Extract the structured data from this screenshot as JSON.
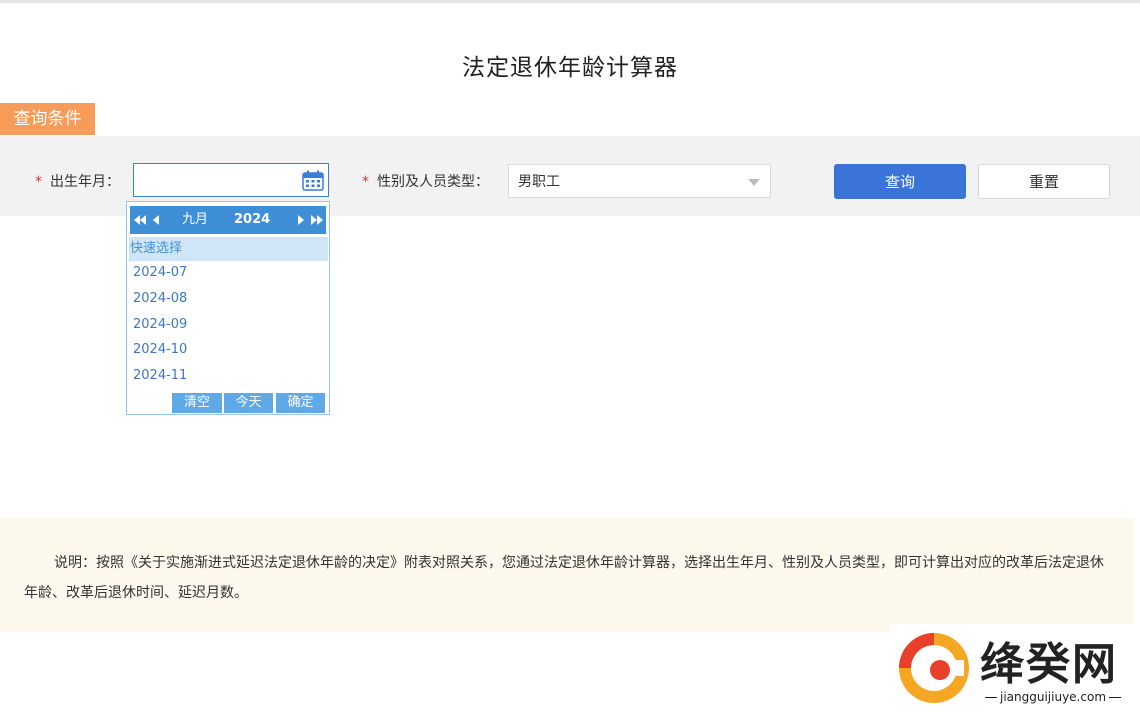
{
  "page": {
    "title": "法定退休年龄计算器"
  },
  "filter": {
    "tab_label": "查询条件",
    "required_mark": "*",
    "birth_label": "出生年月：",
    "birth_value": "",
    "type_label": "性别及人员类型：",
    "type_value": "男职工",
    "query_button": "查询",
    "reset_button": "重置"
  },
  "date_picker": {
    "month": "九月",
    "year": "2024",
    "quick_title": "快速选择",
    "quick_options": [
      "2024-07",
      "2024-08",
      "2024-09",
      "2024-10",
      "2024-11"
    ],
    "clear_button": "清空",
    "today_button": "今天",
    "confirm_button": "确定"
  },
  "note": {
    "text": "说明：按照《关于实施渐进式延迟法定退休年龄的决定》附表对照关系，您通过法定退休年龄计算器，选择出生年月、性别及人员类型，即可计算出对应的改革后法定退休年龄、改革后退休时间、延迟月数。"
  },
  "watermark": {
    "name": "绛癸网",
    "url": "jiangguijiuye.com"
  },
  "icons": {
    "calendar": "calendar-icon",
    "dropdown": "chevron-down-icon",
    "prev_year": "double-left-icon",
    "prev_month": "left-icon",
    "next_month": "right-icon",
    "next_year": "double-right-icon"
  },
  "colors": {
    "accent": "#3b74d8",
    "tab": "#f79b58",
    "picker_head": "#3f8fd7",
    "note_bg": "#fdf8ec"
  }
}
